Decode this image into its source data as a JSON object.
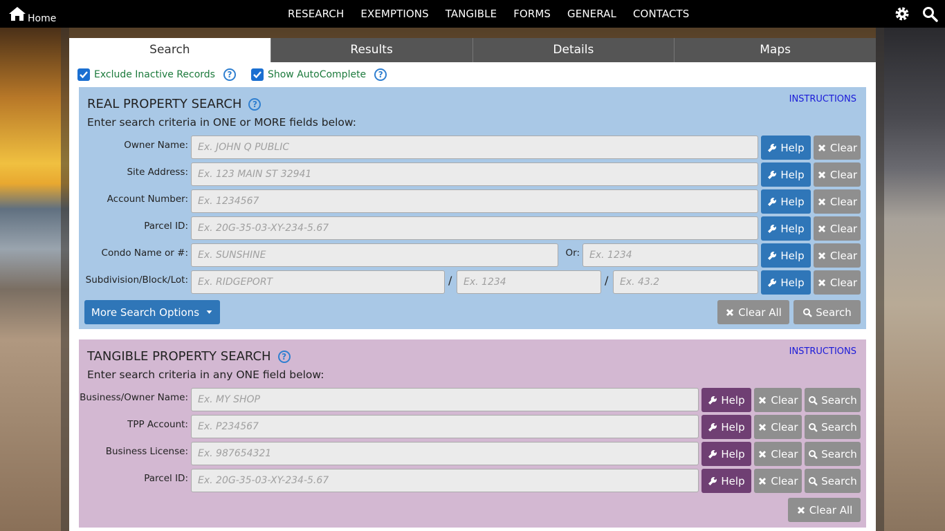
{
  "topbar": {
    "home_label": "Home",
    "nav": [
      "RESEARCH",
      "EXEMPTIONS",
      "TANGIBLE",
      "FORMS",
      "GENERAL",
      "CONTACTS"
    ]
  },
  "tabs": [
    "Search",
    "Results",
    "Details",
    "Maps"
  ],
  "options": {
    "exclude_inactive": "Exclude Inactive Records",
    "show_autocomplete": "Show AutoComplete"
  },
  "real": {
    "title": "REAL PROPERTY SEARCH",
    "subtitle": "Enter search criteria in ONE or MORE fields below:",
    "instructions": "INSTRUCTIONS",
    "owner_label": "Owner Name:",
    "owner_ph": "Ex. JOHN Q PUBLIC",
    "site_label": "Site Address:",
    "site_ph": "Ex. 123 MAIN ST 32941",
    "account_label": "Account Number:",
    "account_ph": "Ex. 1234567",
    "parcel_label": "Parcel ID:",
    "parcel_ph": "Ex. 20G-35-03-XY-234-5.67",
    "condo_label": "Condo Name or #:",
    "condo_ph": "Ex. SUNSHINE",
    "or_label": "Or:",
    "condo_num_ph": "Ex. 1234",
    "subdiv_label": "Subdivision/Block/Lot:",
    "subdiv_ph": "Ex. RIDGEPORT",
    "block_ph": "Ex. 1234",
    "lot_ph": "Ex. 43.2",
    "slash": "/",
    "help": "Help",
    "clear": "Clear",
    "more_options": "More Search Options",
    "clear_all": "Clear All",
    "search": "Search"
  },
  "tangible": {
    "title": "TANGIBLE PROPERTY SEARCH",
    "subtitle": "Enter search criteria in any ONE field below:",
    "instructions": "INSTRUCTIONS",
    "business_label": "Business/Owner Name:",
    "business_ph": "Ex. MY SHOP",
    "tpp_label": "TPP Account:",
    "tpp_ph": "Ex. P234567",
    "license_label": "Business License:",
    "license_ph": "Ex. 987654321",
    "parcel_label": "Parcel ID:",
    "parcel_ph": "Ex. 20G-35-03-XY-234-5.67",
    "help": "Help",
    "clear": "Clear",
    "search": "Search",
    "clear_all": "Clear All"
  }
}
